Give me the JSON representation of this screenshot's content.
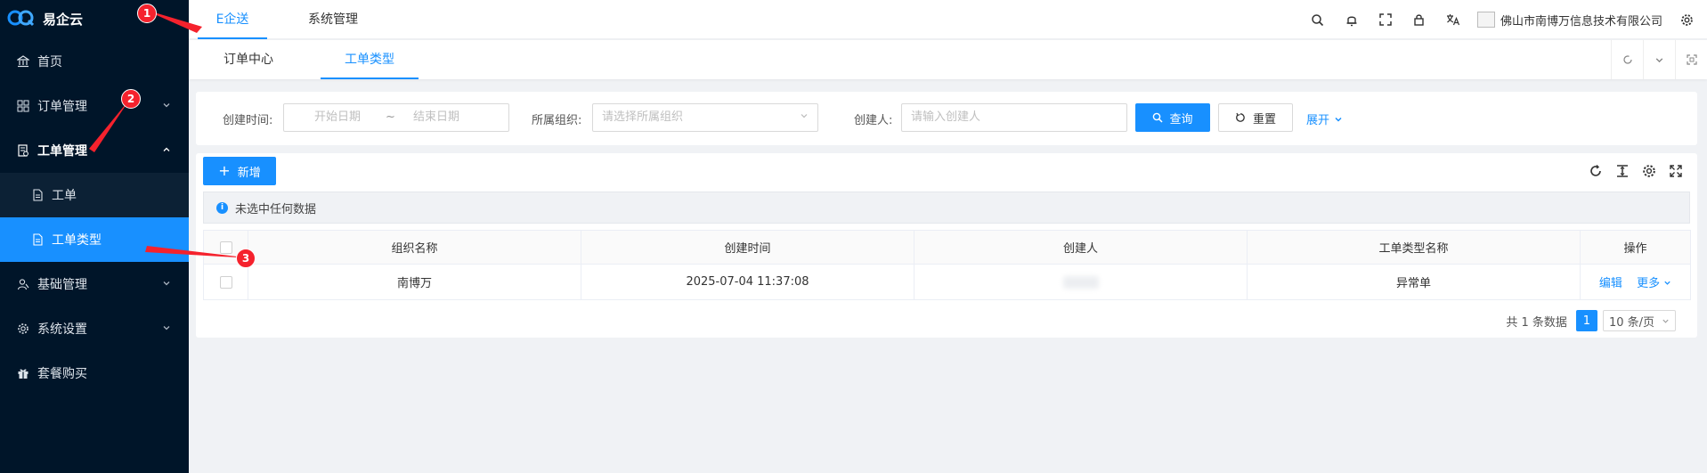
{
  "app": {
    "name": "易企云"
  },
  "sidebar": {
    "items": [
      {
        "label": "首页",
        "icon": "bank-icon"
      },
      {
        "label": "订单管理",
        "icon": "grid-icon"
      },
      {
        "label": "工单管理",
        "icon": "document-icon"
      },
      {
        "label": "工单",
        "icon": "file-icon"
      },
      {
        "label": "工单类型",
        "icon": "file-icon"
      },
      {
        "label": "基础管理",
        "icon": "people-icon"
      },
      {
        "label": "系统设置",
        "icon": "gear-icon"
      },
      {
        "label": "套餐购买",
        "icon": "gift-icon"
      }
    ]
  },
  "header": {
    "tabs": [
      {
        "label": "E企送"
      },
      {
        "label": "系统管理"
      }
    ],
    "company": "佛山市南博万信息技术有限公司"
  },
  "view_tabs": [
    {
      "label": "订单中心"
    },
    {
      "label": "工单类型"
    }
  ],
  "search": {
    "created_time_label": "创建时间:",
    "start_placeholder": "开始日期",
    "range_sep": "~",
    "end_placeholder": "结束日期",
    "org_label": "所属组织:",
    "org_placeholder": "请选择所属组织",
    "creator_label": "创建人:",
    "creator_placeholder": "请输入创建人",
    "query_label": "查询",
    "reset_label": "重置",
    "expand_label": "展开"
  },
  "toolbar": {
    "add_label": "新增"
  },
  "selection_info": "未选中任何数据",
  "table": {
    "columns": [
      "组织名称",
      "创建时间",
      "创建人",
      "工单类型名称",
      "操作"
    ],
    "rows": [
      {
        "org": "南博万",
        "created_time": "2025-07-04 11:37:08",
        "creator": "",
        "type_name": "异常单",
        "edit_label": "编辑",
        "more_label": "更多"
      }
    ]
  },
  "pagination": {
    "total_text": "共 1 条数据",
    "current_page": "1",
    "page_size": "10 条/页"
  },
  "annotations": [
    {
      "label": "1"
    },
    {
      "label": "2"
    },
    {
      "label": "3"
    }
  ],
  "colors": {
    "sidebar_bg": "#001529",
    "accent": "#1890ff",
    "annotation": "#f5222d"
  }
}
